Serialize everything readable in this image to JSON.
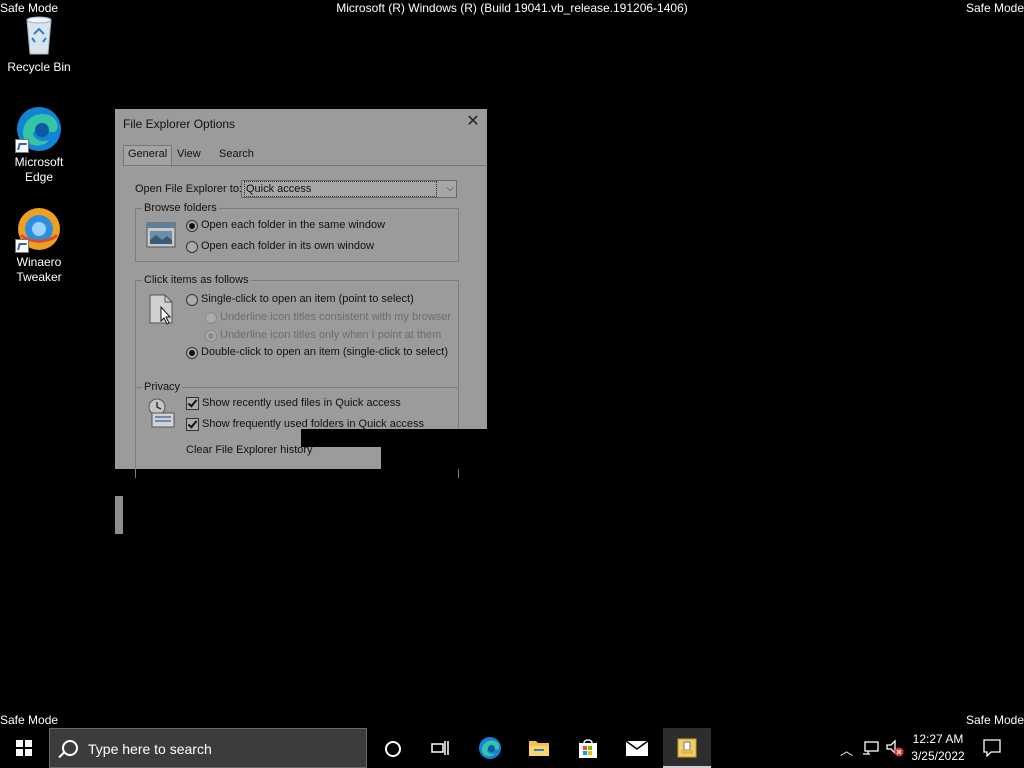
{
  "desktop": {
    "safe_mode_label": "Safe Mode",
    "build_text": "Microsoft (R) Windows (R) (Build 19041.vb_release.191206-1406)",
    "icons": [
      {
        "label": "Recycle Bin"
      },
      {
        "label": "Microsoft\nEdge",
        "label_line1": "Microsoft",
        "label_line2": "Edge"
      },
      {
        "label_line1": "Winaero",
        "label_line2": "Tweaker"
      }
    ]
  },
  "dialog": {
    "title": "File Explorer Options",
    "tabs": [
      "General",
      "View",
      "Search"
    ],
    "open_to_label": "Open File Explorer to:",
    "open_to_value": "Quick access",
    "browse_folders": {
      "title": "Browse folders",
      "options": [
        "Open each folder in the same window",
        "Open each folder in its own window"
      ],
      "selected": 0
    },
    "click_items": {
      "title": "Click items as follows",
      "single_click": "Single-click to open an item (point to select)",
      "underline_browser": "Underline icon titles consistent with my browser",
      "underline_point": "Underline icon titles only when I point at them",
      "double_click": "Double-click to open an item (single-click to select)",
      "selected": "double_click"
    },
    "privacy": {
      "title": "Privacy",
      "show_recent_files": "Show recently used files in Quick access",
      "show_frequent_folders": "Show frequently used folders in Quick access",
      "clear_history": "Clear File Explorer history"
    }
  },
  "taskbar": {
    "search_placeholder": "Type here to search",
    "time": "12:27 AM",
    "date": "3/25/2022"
  }
}
